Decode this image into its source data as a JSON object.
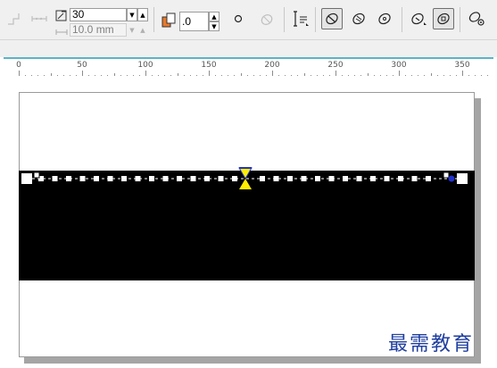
{
  "toolbar": {
    "nib_size": "30",
    "spacing": "10.0 mm",
    "rotation": ".0"
  },
  "ruler": {
    "labels": [
      "0",
      "50",
      "100",
      "150",
      "200",
      "250",
      "300",
      "350"
    ]
  },
  "colors": {
    "toolbar_bg": "#f0f0f0",
    "ruler_accent": "#5ab4c8",
    "shape_fill": "#000000",
    "midpoint_marker": "#ffee00",
    "node_handle": "#2233cc"
  },
  "watermark": "最需教育"
}
